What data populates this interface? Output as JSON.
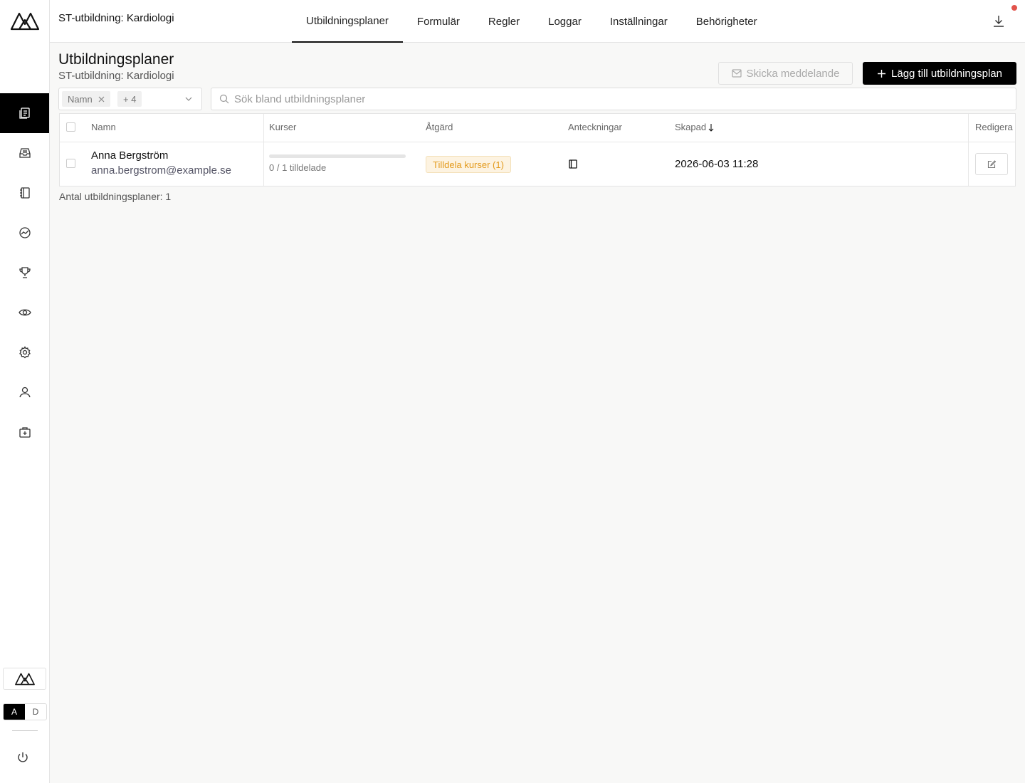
{
  "topbar": {
    "title": "ST-utbildning: Kardiologi",
    "tabs": [
      {
        "label": "Utbildningsplaner",
        "active": true
      },
      {
        "label": "Formulär"
      },
      {
        "label": "Regler"
      },
      {
        "label": "Loggar"
      },
      {
        "label": "Inställningar"
      },
      {
        "label": "Behörigheter"
      }
    ]
  },
  "sidebar": {
    "items": [
      {
        "icon": "documents-icon",
        "active": true
      },
      {
        "icon": "inbox-icon"
      },
      {
        "icon": "notebook-icon"
      },
      {
        "icon": "chart-circle-icon"
      },
      {
        "icon": "trophy-icon"
      },
      {
        "icon": "eye-icon"
      },
      {
        "icon": "gear-icon"
      },
      {
        "icon": "user-icon"
      },
      {
        "icon": "medical-kit-icon"
      }
    ],
    "lang": {
      "a": "A",
      "d": "D",
      "active": "A"
    }
  },
  "page": {
    "title": "Utbildningsplaner",
    "subtitle": "ST-utbildning: Kardiologi",
    "send_message": "Skicka meddelande",
    "add_plan": "Lägg till utbildningsplan"
  },
  "filter": {
    "chip_name": "Namn",
    "chip_more": "+ 4"
  },
  "search": {
    "placeholder": "Sök bland utbildningsplaner"
  },
  "table": {
    "columns": {
      "name": "Namn",
      "courses": "Kurser",
      "action": "Åtgärd",
      "notes": "Anteckningar",
      "created": "Skapad",
      "edit": "Redigera"
    },
    "rows": [
      {
        "name": "Anna Bergström",
        "email": "anna.bergstrom@example.se",
        "progress_fraction": 0,
        "progress_text": "0 / 1 tilldelade",
        "action": "Tilldela kurser (1)",
        "created": "2026-06-03 11:28"
      }
    ]
  },
  "footer": {
    "count": "Antal utbildningsplaner: 1"
  },
  "colors": {
    "accent": "#000000",
    "badge_text": "#e39a1c",
    "badge_bg": "#fdf3e1",
    "notification": "#e2534b"
  }
}
